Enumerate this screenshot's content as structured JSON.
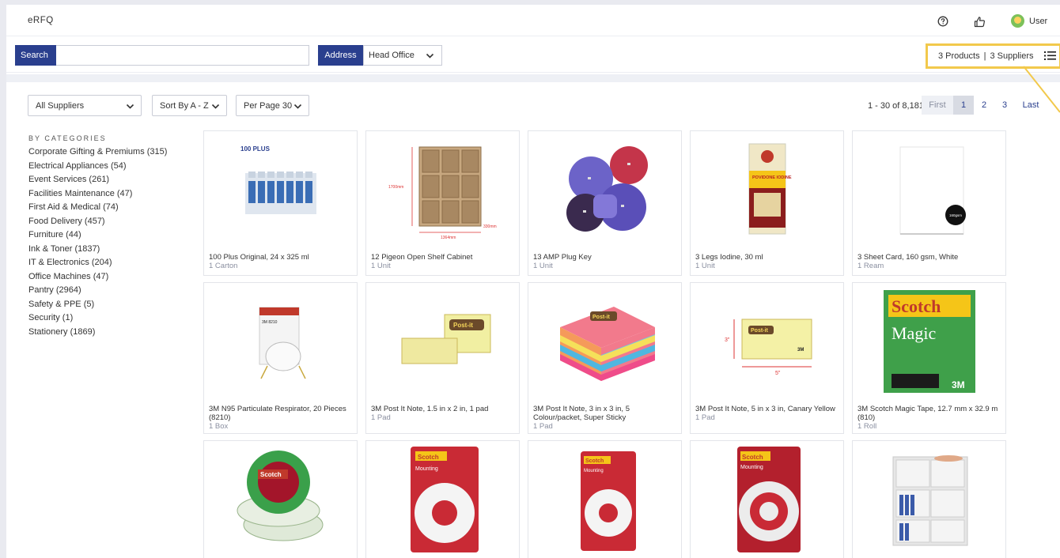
{
  "app": {
    "title": "eRFQ"
  },
  "header": {
    "user_label": "User"
  },
  "search": {
    "button_label": "Search",
    "value": "",
    "placeholder": ""
  },
  "address": {
    "label": "Address",
    "value": "Head Office"
  },
  "summary": {
    "products": "3 Products",
    "separator": "|",
    "suppliers": "3 Suppliers"
  },
  "filters": {
    "suppliers": "All Suppliers",
    "sort": "Sort By A - Z",
    "per_page": "Per Page 30"
  },
  "pagination": {
    "range": "1 - 30 of 8,181",
    "first": "First",
    "pages": [
      "1",
      "2",
      "3"
    ],
    "last": "Last",
    "current": "1"
  },
  "categories": {
    "heading": "BY CATEGORIES",
    "items": [
      "Corporate Gifting & Premiums (315)",
      "Electrical Appliances (54)",
      "Event Services (261)",
      "Facilities Maintenance (47)",
      "First Aid & Medical (74)",
      "Food Delivery (457)",
      "Furniture (44)",
      "Ink & Toner (1837)",
      "IT & Electronics (204)",
      "Office Machines (47)",
      "Pantry (2964)",
      "Safety & PPE (5)",
      "Security (1)",
      "Stationery (1869)"
    ]
  },
  "products": [
    {
      "name": "100 Plus Original, 24 x 325 ml",
      "unit": "1 Carton",
      "image": "drink-carton-image"
    },
    {
      "name": "12 Pigeon Open Shelf Cabinet",
      "unit": "1 Unit",
      "image": "shelf-cabinet-image"
    },
    {
      "name": "13 AMP Plug Key",
      "unit": "1 Unit",
      "image": "plug-key-image"
    },
    {
      "name": "3 Legs Iodine, 30 ml",
      "unit": "1 Unit",
      "image": "iodine-box-image"
    },
    {
      "name": "3 Sheet Card, 160 gsm, White",
      "unit": "1 Ream",
      "image": "sheet-card-image"
    },
    {
      "name": "3M N95 Particulate Respirator, 20 Pieces (8210)",
      "unit": "1 Box",
      "image": "respirator-image"
    },
    {
      "name": "3M Post It Note, 1.5 in x 2 in, 1 pad",
      "unit": "1 Pad",
      "image": "post-it-small-image"
    },
    {
      "name": "3M Post It Note, 3 in x 3 in, 5 Colour/packet, Super Sticky",
      "unit": "1 Pad",
      "image": "post-it-colour-image"
    },
    {
      "name": "3M Post It Note, 5 in x 3 in, Canary Yellow",
      "unit": "1 Pad",
      "image": "post-it-canary-image"
    },
    {
      "name": "3M Scotch Magic Tape, 12.7 mm x 32.9 m (810)",
      "unit": "1 Roll",
      "image": "magic-tape-image"
    },
    {
      "name": "",
      "unit": "",
      "image": "mounting-tape-roll-image"
    },
    {
      "name": "",
      "unit": "",
      "image": "mounting-tape-pack-image"
    },
    {
      "name": "",
      "unit": "",
      "image": "mounting-tape-pack-image"
    },
    {
      "name": "",
      "unit": "",
      "image": "mounting-tape-pack-image"
    },
    {
      "name": "",
      "unit": "",
      "image": "white-cabinet-image"
    }
  ],
  "product_labels": {
    "img_100plus": "100 PLUS",
    "dim_1700": "1700mm",
    "dim_1364": "1364mm",
    "dim_330": "330mm",
    "iodine_brand": "POVIDONE IODINE",
    "card_badge": "160gsm",
    "respirator_brand": "3M 8210",
    "postit_logo": "Post-it",
    "dim_3in": "3\"",
    "dim_5in": "5\"",
    "brand_3m": "3M",
    "scotch": "Scotch",
    "magic": "Magic",
    "mounting": "Mounting"
  },
  "colors": {
    "primary": "#2a3f8e",
    "highlight": "#f2c94c",
    "page_bg": "#e9eaf0"
  }
}
